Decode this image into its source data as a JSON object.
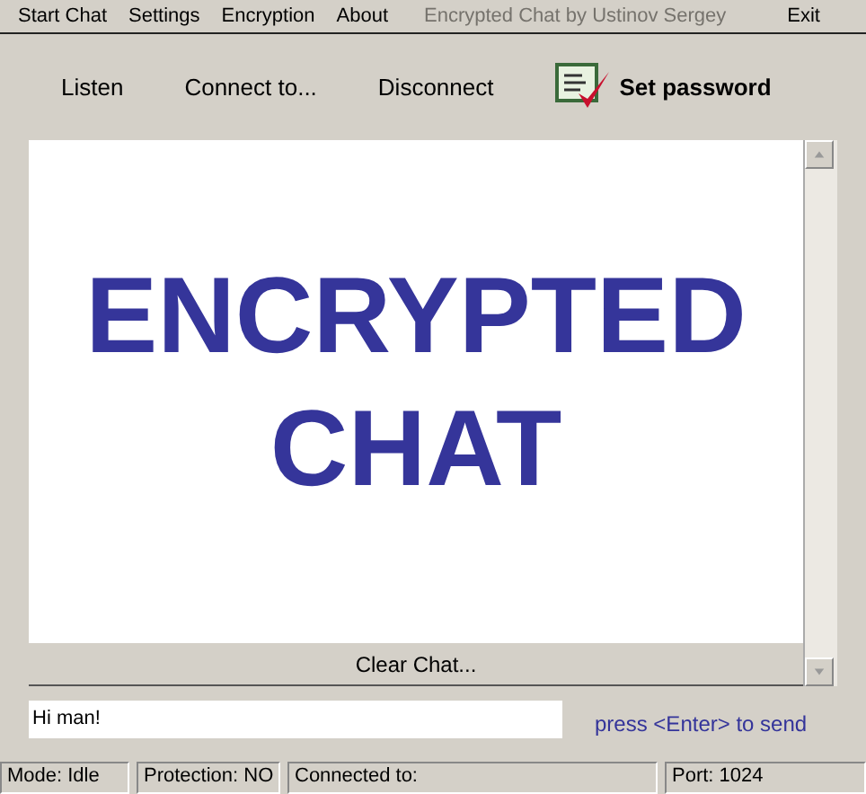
{
  "menu": [
    {
      "label": "Start Chat",
      "kind": "item"
    },
    {
      "label": "Settings",
      "kind": "item"
    },
    {
      "label": "Encryption",
      "kind": "item"
    },
    {
      "label": "About",
      "kind": "item"
    },
    {
      "label": "Encrypted Chat  by Ustinov Sergey",
      "kind": "caption"
    },
    {
      "label": "Exit",
      "kind": "item"
    }
  ],
  "toolbar": [
    {
      "label": "Listen",
      "kind": "plain"
    },
    {
      "label": "Connect to...",
      "kind": "plain"
    },
    {
      "label": "Disconnect",
      "kind": "plain"
    },
    {
      "label": "Set password",
      "kind": "icon"
    }
  ],
  "chat": {
    "lines": [
      "ENCRYPTED",
      "CHAT"
    ],
    "clear_button": "Clear Chat..."
  },
  "message": {
    "value": "Hi man!",
    "hint": "press <Enter> to send"
  },
  "status_bar": [
    "Mode: Idle",
    "Protection: NO",
    "Connected to:",
    "Port: 1024"
  ]
}
